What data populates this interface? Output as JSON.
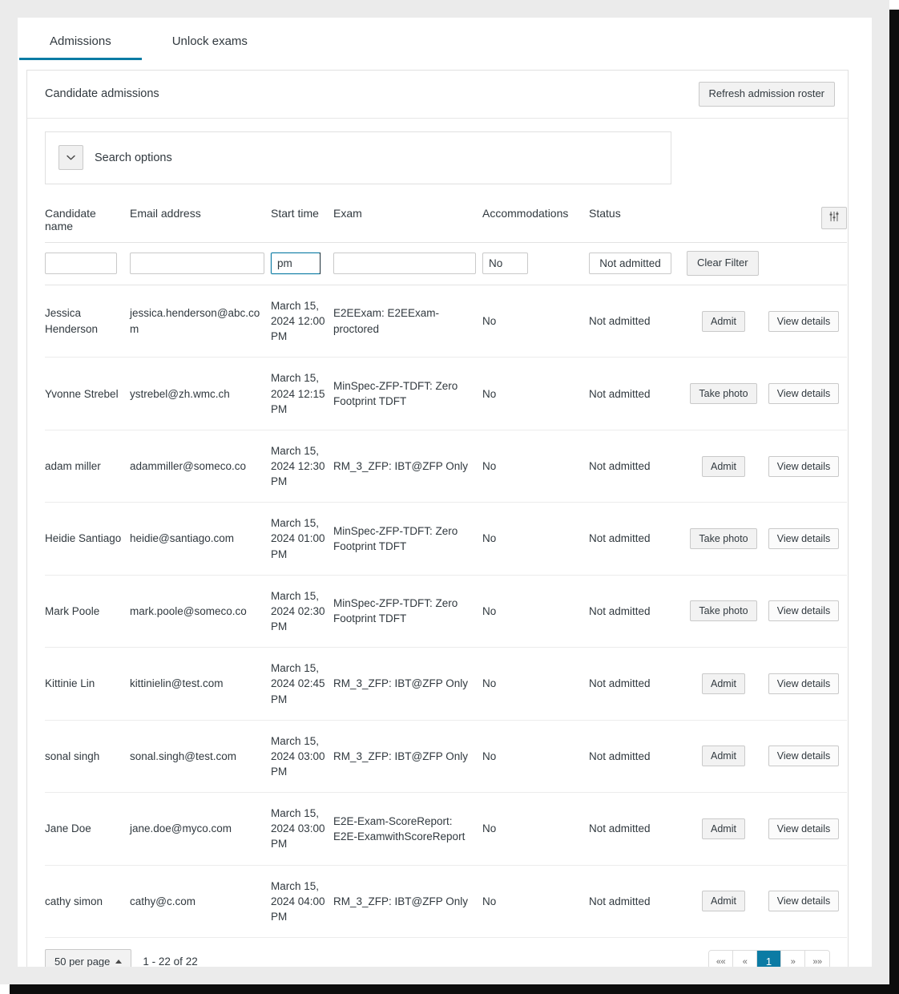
{
  "tabs": [
    {
      "label": "Admissions",
      "active": true
    },
    {
      "label": "Unlock exams",
      "active": false
    }
  ],
  "card": {
    "title": "Candidate admissions",
    "refresh_label": "Refresh admission roster"
  },
  "search_options": {
    "label": "Search options",
    "toggle_icon": "chevron-down-icon"
  },
  "table": {
    "tools_icon": "sliders-filter-icon",
    "columns": [
      "Candidate name",
      "Email address",
      "Start time",
      "Exam",
      "Accommodations",
      "Status",
      "",
      ""
    ],
    "filters": {
      "candidate_name": {
        "value": "",
        "placeholder": ""
      },
      "email": {
        "value": "",
        "placeholder": ""
      },
      "start_time": {
        "value": "pm",
        "placeholder": "",
        "focused": true
      },
      "exam": {
        "value": "",
        "placeholder": ""
      },
      "accommodations": {
        "value": "No"
      },
      "status": {
        "value": "Not admitted"
      },
      "clear_label": "Clear Filter"
    },
    "rows": [
      {
        "name": "Jessica Henderson",
        "email": "jessica.henderson@abc.com",
        "start_time": "March 15, 2024 12:00 PM",
        "exam": "E2EExam: E2EExam-proctored",
        "accommodations": "No",
        "status": "Not admitted",
        "action": "Admit",
        "details": "View details"
      },
      {
        "name": "Yvonne Strebel",
        "email": "ystrebel@zh.wmc.ch",
        "start_time": "March 15, 2024 12:15 PM",
        "exam": "MinSpec-ZFP-TDFT: Zero Footprint TDFT",
        "accommodations": "No",
        "status": "Not admitted",
        "action": "Take photo",
        "details": "View details"
      },
      {
        "name": "adam miller",
        "email": "adammiller@someco.co",
        "start_time": "March 15, 2024 12:30 PM",
        "exam": "RM_3_ZFP: IBT@ZFP Only",
        "accommodations": "No",
        "status": "Not admitted",
        "action": "Admit",
        "details": "View details"
      },
      {
        "name": "Heidie Santiago",
        "email": "heidie@santiago.com",
        "start_time": "March 15, 2024 01:00 PM",
        "exam": "MinSpec-ZFP-TDFT: Zero Footprint TDFT",
        "accommodations": "No",
        "status": "Not admitted",
        "action": "Take photo",
        "details": "View details"
      },
      {
        "name": "Mark Poole",
        "email": "mark.poole@someco.co",
        "start_time": "March 15, 2024 02:30 PM",
        "exam": "MinSpec-ZFP-TDFT: Zero Footprint TDFT",
        "accommodations": "No",
        "status": "Not admitted",
        "action": "Take photo",
        "details": "View details"
      },
      {
        "name": "Kittinie Lin",
        "email": "kittinielin@test.com",
        "start_time": "March 15, 2024 02:45 PM",
        "exam": "RM_3_ZFP: IBT@ZFP Only",
        "accommodations": "No",
        "status": "Not admitted",
        "action": "Admit",
        "details": "View details"
      },
      {
        "name": "sonal singh",
        "email": "sonal.singh@test.com",
        "start_time": "March 15, 2024 03:00 PM",
        "exam": "RM_3_ZFP: IBT@ZFP Only",
        "accommodations": "No",
        "status": "Not admitted",
        "action": "Admit",
        "details": "View details"
      },
      {
        "name": "Jane Doe",
        "email": "jane.doe@myco.com",
        "start_time": "March 15, 2024 03:00 PM",
        "exam": "E2E-Exam-ScoreReport: E2E-ExamwithScoreReport",
        "accommodations": "No",
        "status": "Not admitted",
        "action": "Admit",
        "details": "View details"
      },
      {
        "name": "cathy simon",
        "email": "cathy@c.com",
        "start_time": "March 15, 2024 04:00 PM",
        "exam": "RM_3_ZFP: IBT@ZFP Only",
        "accommodations": "No",
        "status": "Not admitted",
        "action": "Admit",
        "details": "View details"
      }
    ]
  },
  "footer": {
    "per_page_label": "50 per page",
    "range_label": "1 - 22 of 22",
    "pagination": [
      {
        "label": "««",
        "name": "first-page",
        "active": false
      },
      {
        "label": "«",
        "name": "prev-page",
        "active": false
      },
      {
        "label": "1",
        "name": "page-1",
        "active": true
      },
      {
        "label": "»",
        "name": "next-page",
        "active": false
      },
      {
        "label": "»»",
        "name": "last-page",
        "active": false
      }
    ]
  },
  "colors": {
    "accent": "#0b7ba4",
    "text": "#31393f",
    "border": "#e0e0e0",
    "frame": "#ebebeb"
  }
}
